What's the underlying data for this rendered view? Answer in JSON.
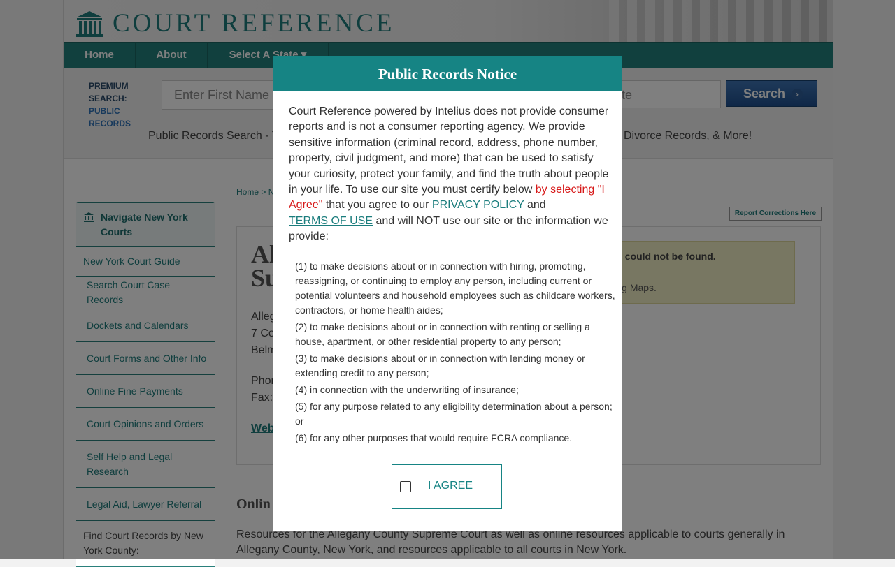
{
  "header": {
    "logo_text": "COURT REFERENCE"
  },
  "nav": {
    "items": [
      "Home",
      "About",
      "Select A State"
    ]
  },
  "search": {
    "premium_line1": "PREMIUM",
    "premium_line2": "SEARCH:",
    "premium_line3": "PUBLIC",
    "premium_line4": "RECORDS",
    "first_name_placeholder": "Enter First Name",
    "state_placeholder": "tate",
    "button_label": "Search",
    "tagline_left": "Public Records Search - Y",
    "tagline_right": "Divorce Records, & More!"
  },
  "breadcrumb": {
    "home": "Home",
    "sep": " > N"
  },
  "report_button": "Report Corrections Here",
  "sidebar": {
    "title": "Navigate New York Courts",
    "guide": "New York Court Guide",
    "items": [
      "Search Court Case Records",
      "Dockets and Calendars",
      "Court Forms and Other Info",
      "Online Fine Payments",
      "Court Opinions and Orders",
      "Self Help and Legal Research",
      "Legal Aid, Lawyer Referral"
    ],
    "find_label": "Find Court Records by New York County:"
  },
  "court": {
    "title_line1": "Al",
    "title_line2": "Su",
    "addr1": "Alleg",
    "addr2": "7 Co",
    "addr3": "Belm",
    "phone": "Phon",
    "fax": "Fax:",
    "web": "Web"
  },
  "map_note": {
    "line1": "ourt map could not be found.",
    "line2": "ate to Bing Maps."
  },
  "online_heading": "Onlin",
  "resources_text": "Resources for the Allegany County Supreme Court as well as online resources applicable to courts generally in Allegany County, New York, and resources applicable to all courts in New York.",
  "modal": {
    "title": "Public Records Notice",
    "intro_part1": "Court Reference powered by Intelius does not provide consumer reports and is not a consumer reporting agency. We provide sensitive information (criminal record, address, phone number, property, civil judgment, and more) that can be used to satisfy your curiosity, protect your family, and find the truth about people in your life. To use our site you must certify below ",
    "intro_red": "by selecting \"I Agree\"",
    "intro_part2": " that you agree to our ",
    "privacy_link": "PRIVACY POLICY",
    "intro_part3": " and ",
    "terms_link": "TERMS OF USE",
    "intro_part4": " and will NOT use our site or the information we provide:",
    "items": [
      "(1) to make decisions about or in connection with hiring, promoting, reassigning, or continuing to employ any person, including current or potential volunteers and household employees such as childcare workers, contractors, or home health aides;",
      "(2) to make decisions about or in connection with renting or selling a house, apartment, or other residential property to any person;",
      "(3) to make decisions about or in connection with lending money or extending credit to any person;",
      "(4) in connection with the underwriting of insurance;",
      "(5) for any purpose related to any eligibility determination about a person; or",
      "(6) for any other purposes that would require FCRA compliance."
    ],
    "agree_label": "I AGREE",
    "agree_checked": false
  },
  "colors": {
    "teal": "#168484",
    "nav_teal": "#23807c",
    "search_blue": "#1f4f8e",
    "notice_red": "#d71919"
  }
}
